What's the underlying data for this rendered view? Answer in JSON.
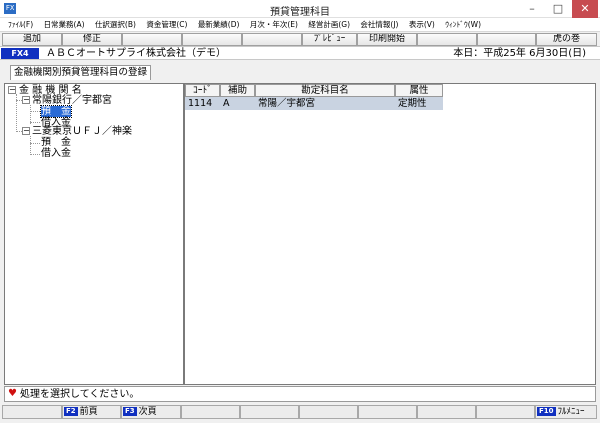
{
  "window": {
    "title": "預貸管理科目",
    "app_icon": "FX",
    "controls": {
      "minimize": "–",
      "maximize": "□",
      "close": "✕"
    }
  },
  "menu": [
    "ﾌｧｲﾙ(F)",
    "日常業務(A)",
    "仕訳選択(B)",
    "資金管理(C)",
    "最新業績(D)",
    "月次・年次(E)",
    "経営計画(G)",
    "会社情報(J)",
    "表示(V)",
    "ｳｨﾝﾄﾞｳ(W)"
  ],
  "toolbar": {
    "add_label": "追加",
    "edit_label": "修正",
    "preview_label": "ﾌﾟﾚﾋﾞｭｰ",
    "print_label": "印刷開始",
    "help_label": "虎の巻"
  },
  "info": {
    "product": "FX4",
    "company": "ＡＢＣオートサプライ株式会社（デモ）",
    "today": "本日：平成25年 6月30日(日)"
  },
  "tab": {
    "label": "金融機関別預貸管理科目の登録"
  },
  "tree": {
    "root": "金 融 機 関 名",
    "banks": [
      {
        "name": "常陽銀行／宇都宮",
        "items": [
          "預　金",
          "借入金"
        ]
      },
      {
        "name": "三菱東京ＵＦＪ／神楽",
        "items": [
          "預　金",
          "借入金"
        ]
      }
    ]
  },
  "grid": {
    "columns": [
      "ｺｰﾄﾞ",
      "補助",
      "勘定科目名",
      "属性"
    ],
    "rows": [
      {
        "code": "1114",
        "sub": "A",
        "name": "常陽／宇都宮",
        "attr": "定期性"
      }
    ]
  },
  "status": {
    "message": "処理を選択してください。"
  },
  "fkeys": [
    {
      "key": "F2",
      "label": "前頁"
    },
    {
      "key": "F3",
      "label": "次頁"
    },
    {
      "key": "F10",
      "label": "ﾌﾙﾒﾆｭｰ"
    }
  ],
  "colors": {
    "accent": "#1030c0",
    "selection": "#2a6bd6",
    "grid_row": "#c9d3e1",
    "close_button": "#c74b50"
  }
}
